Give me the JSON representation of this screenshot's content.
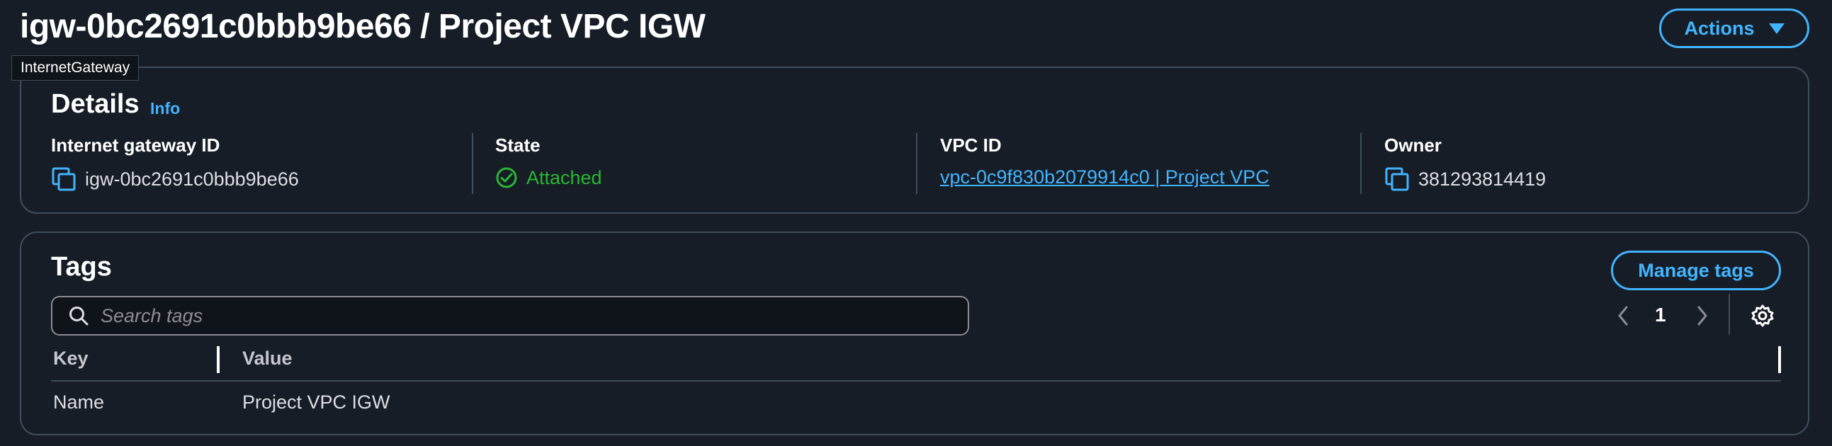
{
  "header": {
    "title": "igw-0bc2691c0bbb9be66 / Project VPC IGW",
    "actions_label": "Actions",
    "tooltip": "InternetGateway"
  },
  "details": {
    "title": "Details",
    "info_label": "Info",
    "fields": [
      {
        "label": "Internet gateway ID",
        "value": "igw-0bc2691c0bbb9be66",
        "icon": "copy-icon"
      },
      {
        "label": "State",
        "value": "Attached",
        "icon": "check-circle-icon"
      },
      {
        "label": "VPC ID",
        "value": "vpc-0c9f830b2079914c0 | Project VPC"
      },
      {
        "label": "Owner",
        "value": "381293814419",
        "icon": "copy-icon"
      }
    ]
  },
  "tags": {
    "title": "Tags",
    "manage_label": "Manage tags",
    "search_placeholder": "Search tags",
    "page_number": "1",
    "columns": [
      "Key",
      "Value"
    ],
    "rows": [
      {
        "key": "Name",
        "value": "Project VPC IGW"
      }
    ]
  },
  "colors": {
    "background": "#161d26",
    "accent": "#42b4ff",
    "success": "#2bb534",
    "border": "#414d5c"
  }
}
